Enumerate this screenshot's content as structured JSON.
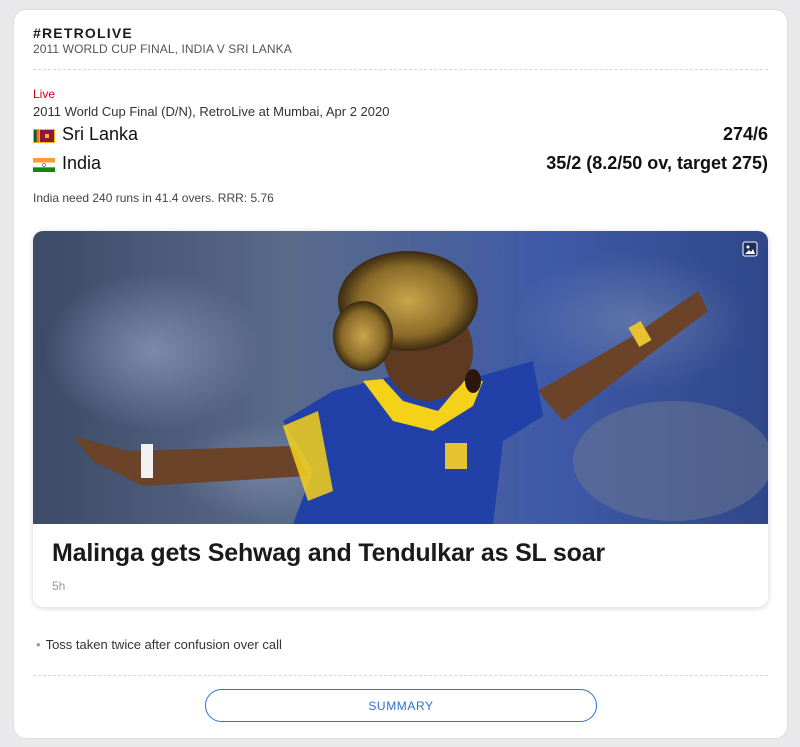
{
  "header": {
    "title": "#RETROLIVE",
    "subtitle": "2011 WORLD CUP FINAL, INDIA V SRI LANKA"
  },
  "match": {
    "status_label": "Live",
    "info": "2011 World Cup Final (D/N), RetroLive at Mumbai, Apr 2 2020",
    "teams": [
      {
        "name": "Sri Lanka",
        "score": "274/6",
        "flag": "sri-lanka-flag-icon"
      },
      {
        "name": "India",
        "score": "35/2 (8.2/50 ov, target 275)",
        "flag": "india-flag-icon"
      }
    ],
    "status_text": "India need 240 runs in 41.4 overs. RRR: 5.76"
  },
  "story": {
    "headline": "Malinga gets Sehwag and Tendulkar as SL soar",
    "timestamp": "5h",
    "image_icon": "image-icon"
  },
  "bullets": [
    "Toss taken twice after confusion over call"
  ],
  "summary_button": "SUMMARY",
  "colors": {
    "live_red": "#d0021b",
    "link_blue": "#2a72d4",
    "sri_lanka_jersey": "#1f3fa8",
    "sri_lanka_yellow": "#f4d21a"
  }
}
